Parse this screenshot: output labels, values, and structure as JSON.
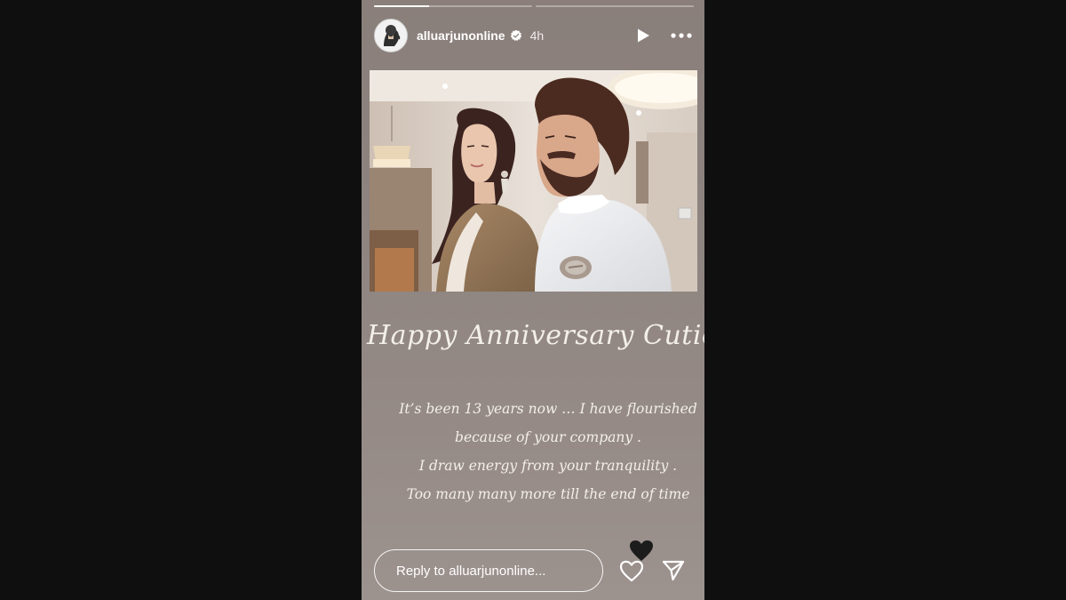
{
  "story": {
    "progress": [
      1,
      0,
      0
    ],
    "progress_active_fraction": 0.35,
    "header": {
      "username": "alluarjunonline",
      "verified": true,
      "timestamp": "4h",
      "icons": {
        "avatar": "profile-avatar",
        "verified": "verified-badge-icon",
        "play": "play-icon",
        "more": "more-options-icon"
      }
    },
    "photo": {
      "alt": "Couple photo"
    },
    "headline": "Happy Anniversary Cutie",
    "message_lines": [
      "It’s been 13 years now … I have flourished",
      "because of your company .",
      "I draw energy from your tranquility .",
      "Too many many more till the end of time"
    ],
    "footer": {
      "reply_placeholder": "Reply to alluarjunonline...",
      "icons": {
        "reaction": "black-heart-reaction-icon",
        "like": "heart-outline-icon",
        "send": "send-paper-plane-icon"
      }
    }
  },
  "colors": {
    "page_background": "#0f0f0f",
    "story_background": "#8e8480",
    "text": "#ffffff"
  }
}
